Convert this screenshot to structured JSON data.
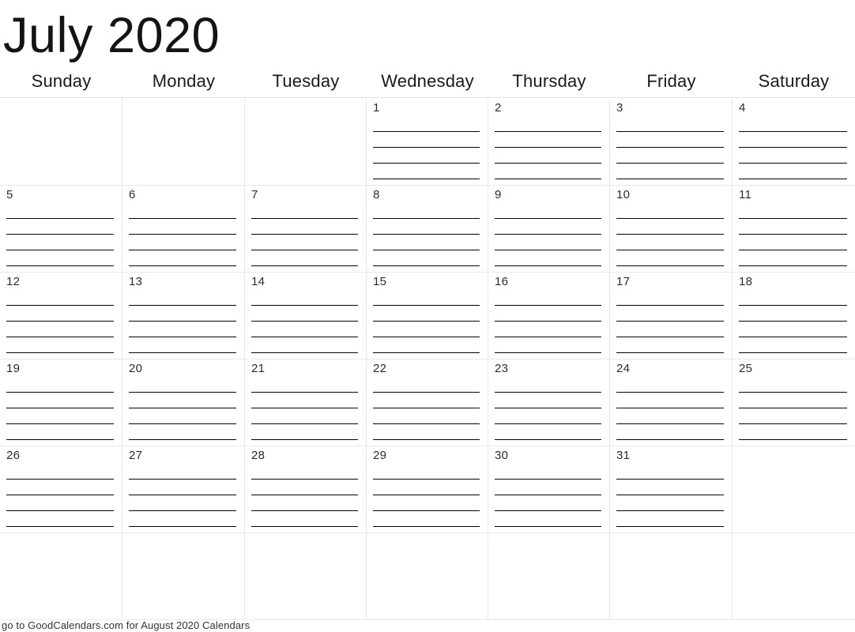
{
  "calendar": {
    "title": "July 2020",
    "month": "July",
    "year": "2020",
    "weekdays": [
      "Sunday",
      "Monday",
      "Tuesday",
      "Wednesday",
      "Thursday",
      "Friday",
      "Saturday"
    ],
    "lines_per_day": 4,
    "rows": 6,
    "columns": 7,
    "weeks": [
      [
        "",
        "",
        "",
        "1",
        "2",
        "3",
        "4"
      ],
      [
        "5",
        "6",
        "7",
        "8",
        "9",
        "10",
        "11"
      ],
      [
        "12",
        "13",
        "14",
        "15",
        "16",
        "17",
        "18"
      ],
      [
        "19",
        "20",
        "21",
        "22",
        "23",
        "24",
        "25"
      ],
      [
        "26",
        "27",
        "28",
        "29",
        "30",
        "31",
        ""
      ],
      [
        "",
        "",
        "",
        "",
        "",
        "",
        ""
      ]
    ],
    "colors": {
      "page_background": "#ffffff",
      "text": "#141414",
      "grid_line": "#e8e8e8",
      "header_rule": "#e0e0e0",
      "write_line": "#050505",
      "date_number": "#2b2b2b",
      "footer_text": "#333333"
    }
  },
  "footer": {
    "note": "go to GoodCalendars.com for August 2020 Calendars"
  }
}
